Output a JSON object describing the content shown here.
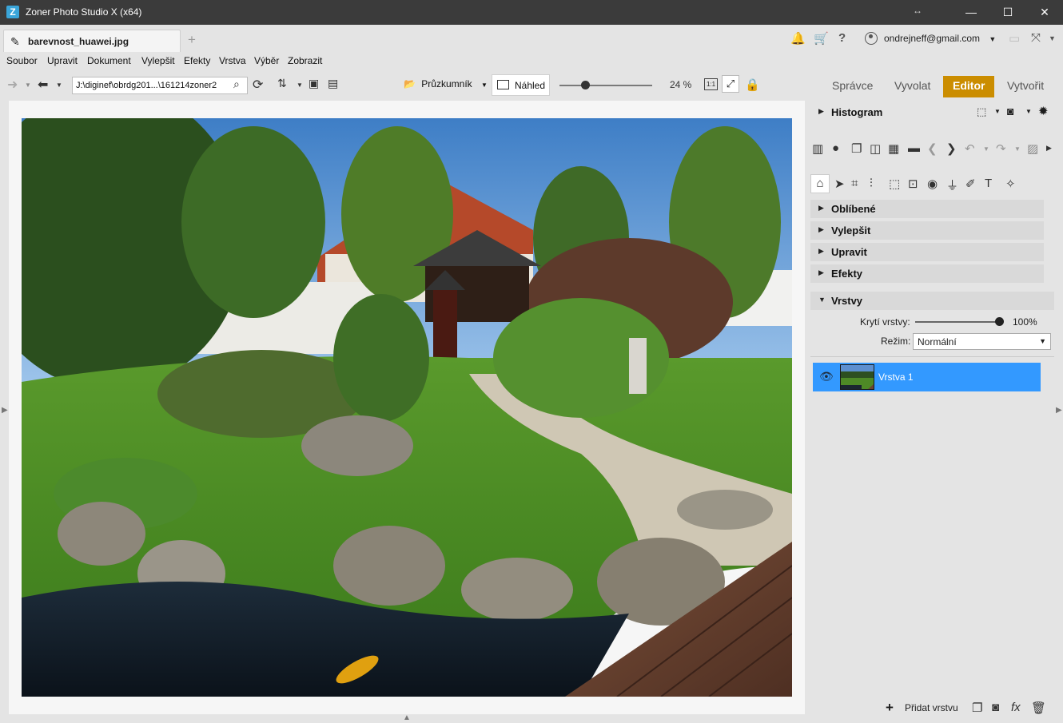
{
  "window": {
    "title": "Zoner Photo Studio X (x64)",
    "minimize": "—",
    "maximize": "☐",
    "close": "✕"
  },
  "tabs": {
    "document_name": "barevnost_huawei.jpg",
    "new_tab": "+"
  },
  "account": {
    "email": "ondrejneff@gmail.com"
  },
  "menu": [
    "Soubor",
    "Upravit",
    "Dokument",
    "Vylepšit",
    "Efekty",
    "Vrstva",
    "Výběr",
    "Zobrazit"
  ],
  "toolbar": {
    "path": "J:\\diginef\\obrdg201...\\161214zoner2",
    "browser_label": "Průzkumník",
    "preview_label": "Náhled",
    "zoom": "24 %",
    "zoom_fraction": 0.24,
    "actual_size": "1:1"
  },
  "modules": [
    "Správce",
    "Vyvolat",
    "Editor",
    "Vytvořit"
  ],
  "active_module": "Editor",
  "panel": {
    "histogram": "Histogram",
    "sections": [
      "Oblíbené",
      "Vylepšit",
      "Upravit",
      "Efekty"
    ],
    "layers_title": "Vrstvy",
    "opacity_label": "Krytí vrstvy:",
    "opacity_value": "100%",
    "opacity_fraction": 1.0,
    "mode_label": "Režim:",
    "mode_value": "Normální",
    "layer_name": "Vrstva 1",
    "add_layer": "Přidat vrstvu",
    "fx": "fx"
  },
  "colors": {
    "accent": "#cb8d00",
    "selection": "#3399ff",
    "titlebar": "#3b3b3b"
  },
  "icons": {
    "edit": "pencil-icon",
    "notifications": "bell-icon",
    "cart": "cart-icon",
    "help": "help-icon",
    "search": "search-icon",
    "refresh": "refresh-icon",
    "sort": "sort-icon",
    "lock": "lock-icon",
    "eye": "eye-icon",
    "trash": "trash-icon"
  }
}
